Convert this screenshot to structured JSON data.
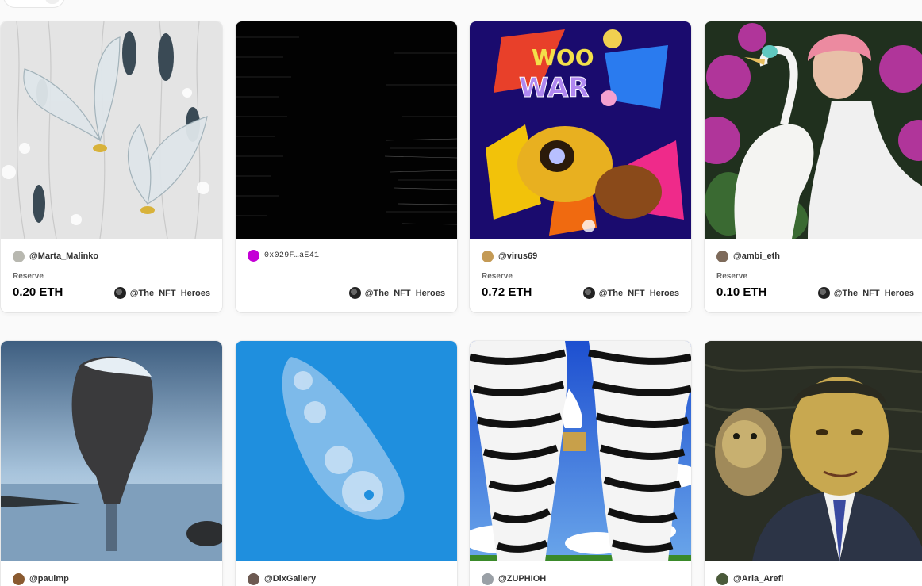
{
  "cards": [
    {
      "creator": "@Marta_Malinko",
      "reserve_label": "Reserve",
      "price": "0.20 ETH",
      "owner": "@The_NFT_Heroes",
      "avatar_color": "#b8b8b0"
    },
    {
      "creator": "0x029F…aE41",
      "owner": "@The_NFT_Heroes",
      "avatar_color": "#c400d6"
    },
    {
      "creator": "@virus69",
      "reserve_label": "Reserve",
      "price": "0.72 ETH",
      "owner": "@The_NFT_Heroes",
      "avatar_color": "#c49a55"
    },
    {
      "creator": "@ambi_eth",
      "reserve_label": "Reserve",
      "price": "0.10 ETH",
      "owner": "@The_NFT_Heroes",
      "avatar_color": "#7d6a5a"
    },
    {
      "creator": "@paulmp",
      "avatar_color": "#8a5a30"
    },
    {
      "creator": "@DixGallery",
      "avatar_color": "#6d5a52"
    },
    {
      "creator": "@ZUPHIOH",
      "avatar_color": "#9aa0a6"
    },
    {
      "creator": "@Aria_Arefi",
      "avatar_color": "#4a5a3a"
    }
  ]
}
